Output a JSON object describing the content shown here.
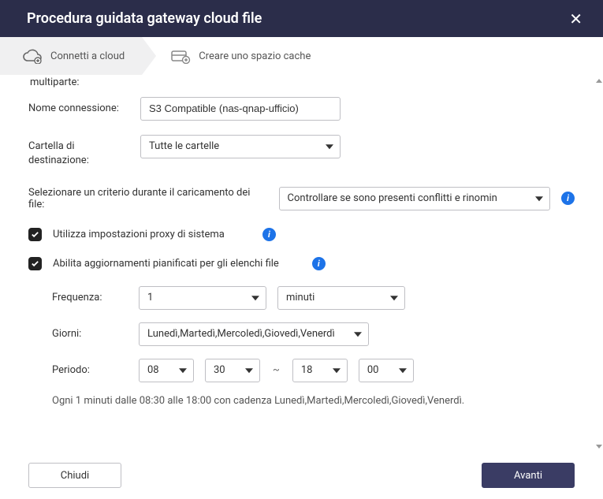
{
  "title": "Procedura guidata gateway cloud file",
  "steps": {
    "step1": "Connetti a cloud",
    "step2": "Creare uno spazio cache"
  },
  "truncated_label_top": "multiparte:",
  "conn_name": {
    "label": "Nome connessione:",
    "value": "S3 Compatible (nas-qnap-ufficio)"
  },
  "dest_folder": {
    "label": "Cartella di destinazione:",
    "value": "Tutte le cartelle"
  },
  "upload_policy": {
    "label": "Selezionare un criterio durante il caricamento dei file:",
    "value": "Controllare se sono presenti conflitti e rinomin"
  },
  "proxy": {
    "label": "Utilizza impostazioni proxy di sistema"
  },
  "scheduled": {
    "label": "Abilita aggiornamenti pianificati per gli elenchi file"
  },
  "schedule": {
    "freq_label": "Frequenza:",
    "freq_value": "1",
    "freq_unit": "minuti",
    "days_label": "Giorni:",
    "days_value": "Lunedì,Martedì,Mercoledì,Giovedì,Venerdì",
    "period_label": "Periodo:",
    "from_h": "08",
    "from_m": "30",
    "to_h": "18",
    "to_m": "00",
    "summary": "Ogni 1 minuti dalle 08:30 alle 18:00 con cadenza Lunedì,Martedì,Mercoledì,Giovedì,Venerdì."
  },
  "buttons": {
    "close": "Chiudi",
    "next": "Avanti"
  }
}
